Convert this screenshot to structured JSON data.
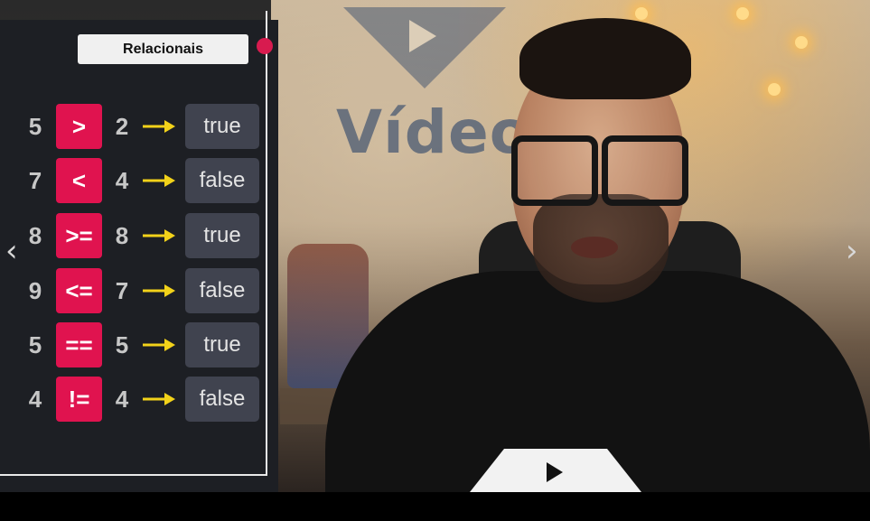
{
  "panel": {
    "title": "Relacionais",
    "rows": [
      {
        "a": "5",
        "op": ">",
        "b": "2",
        "result": "true"
      },
      {
        "a": "7",
        "op": "<",
        "b": "4",
        "result": "false"
      },
      {
        "a": "8",
        "op": ">=",
        "b": "8",
        "result": "true"
      },
      {
        "a": "9",
        "op": "<=",
        "b": "7",
        "result": "false"
      },
      {
        "a": "5",
        "op": "==",
        "b": "5",
        "result": "true"
      },
      {
        "a": "4",
        "op": "!=",
        "b": "4",
        "result": "false"
      }
    ]
  },
  "background": {
    "logo_word": "Vídeo"
  },
  "nav": {
    "prev_icon": "chevron-left-icon",
    "next_icon": "chevron-right-icon"
  },
  "colors": {
    "operator_bg": "#e0134f",
    "result_bg": "#40434f",
    "arrow": "#f2d21a",
    "panel_bg": "#1d1f24"
  }
}
